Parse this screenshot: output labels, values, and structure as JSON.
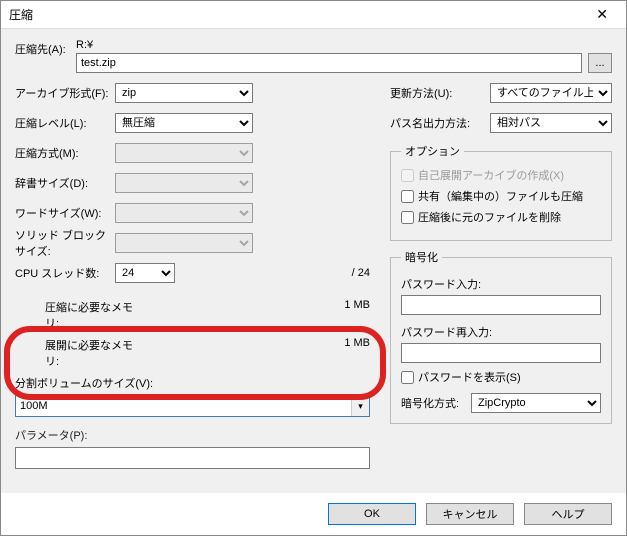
{
  "window": {
    "title": "圧縮"
  },
  "dest": {
    "label": "圧縮先(A):",
    "drive": "R:¥",
    "filename": "test.zip",
    "browse": "..."
  },
  "left": {
    "archive_format": {
      "label": "アーカイブ形式(F):",
      "value": "zip"
    },
    "compress_level": {
      "label": "圧縮レベル(L):",
      "value": "無圧縮"
    },
    "compress_method": {
      "label": "圧縮方式(M):"
    },
    "dict_size": {
      "label": "辞書サイズ(D):"
    },
    "word_size": {
      "label": "ワードサイズ(W):"
    },
    "solid_block": {
      "label": "ソリッド ブロック サイズ:"
    },
    "cpu_threads": {
      "label": "CPU スレッド数:",
      "value": "24",
      "total": "/ 24"
    },
    "mem_compress": {
      "label": "圧縮に必要なメモリ:",
      "value": "1 MB"
    },
    "mem_extract": {
      "label": "展開に必要なメモリ:",
      "value": "1 MB"
    },
    "split_volume": {
      "label": "分割ボリュームのサイズ(V):",
      "value": "100M"
    },
    "parameters": {
      "label": "パラメータ(P):"
    }
  },
  "right": {
    "update_mode": {
      "label": "更新方法(U):",
      "value": "すべてのファイル上書き"
    },
    "path_mode": {
      "label": "パス名出力方法:",
      "value": "相対パス"
    },
    "options": {
      "legend": "オプション",
      "sfx": "自己展開アーカイブの作成(X)",
      "shared": "共有（編集中の）ファイルも圧縮",
      "delete_after": "圧縮後に元のファイルを削除"
    },
    "encryption": {
      "legend": "暗号化",
      "pw": "パスワード入力:",
      "pw2": "パスワード再入力:",
      "show_pw": "パスワードを表示(S)",
      "method_label": "暗号化方式:",
      "method_value": "ZipCrypto"
    }
  },
  "buttons": {
    "ok": "OK",
    "cancel": "キャンセル",
    "help": "ヘルプ"
  }
}
